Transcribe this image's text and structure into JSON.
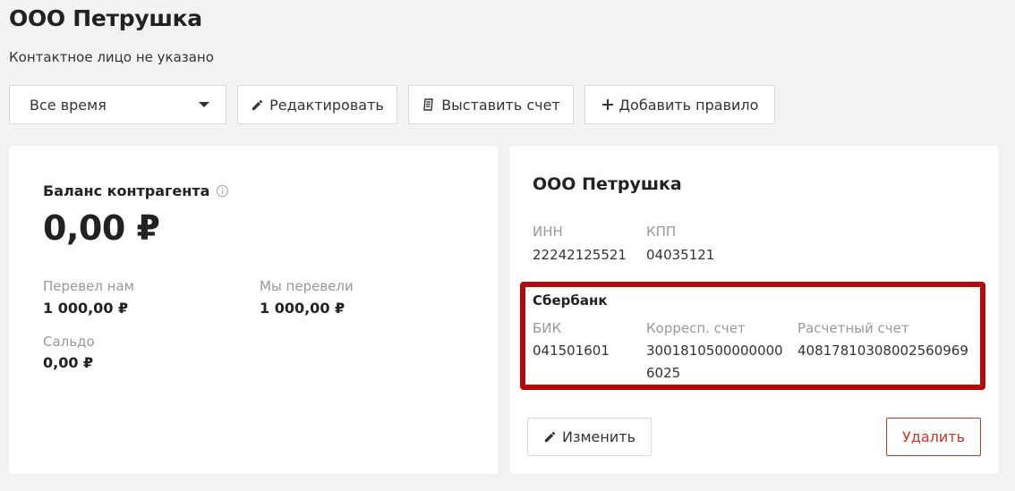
{
  "header": {
    "title": "ООО Петрушка",
    "subtitle": "Контактное лицо не указано"
  },
  "toolbar": {
    "period_select": "Все время",
    "edit_label": "Редактировать",
    "invoice_label": "Выставить счет",
    "add_rule_label": "Добавить правило"
  },
  "balance": {
    "title": "Баланс контрагента",
    "amount": "0,00 ₽",
    "received_label": "Перевел нам",
    "received_value": "1 000,00 ₽",
    "sent_label": "Мы перевели",
    "sent_value": "1 000,00 ₽",
    "saldo_label": "Сальдо",
    "saldo_value": "0,00 ₽"
  },
  "company": {
    "name": "ООО Петрушка",
    "inn_label": "ИНН",
    "inn_value": "22242125521",
    "kpp_label": "КПП",
    "kpp_value": "04035121",
    "bank": {
      "name": "Сбербанк",
      "bik_label": "БИК",
      "bik_value": "041501601",
      "corr_label": "Корресп. счет",
      "corr_value_line1": "3001810500000000",
      "corr_value_line2": "6025",
      "account_label": "Расчетный счет",
      "account_value": "40817810308002560969"
    },
    "change_label": "Изменить",
    "delete_label": "Удалить"
  },
  "colors": {
    "highlight": "#b30b0b",
    "danger": "#c0392b",
    "background": "#f3f3f3"
  },
  "icons": [
    "chevron-down-icon",
    "pencil-icon",
    "receipt-icon",
    "plus-icon",
    "info-icon"
  ]
}
